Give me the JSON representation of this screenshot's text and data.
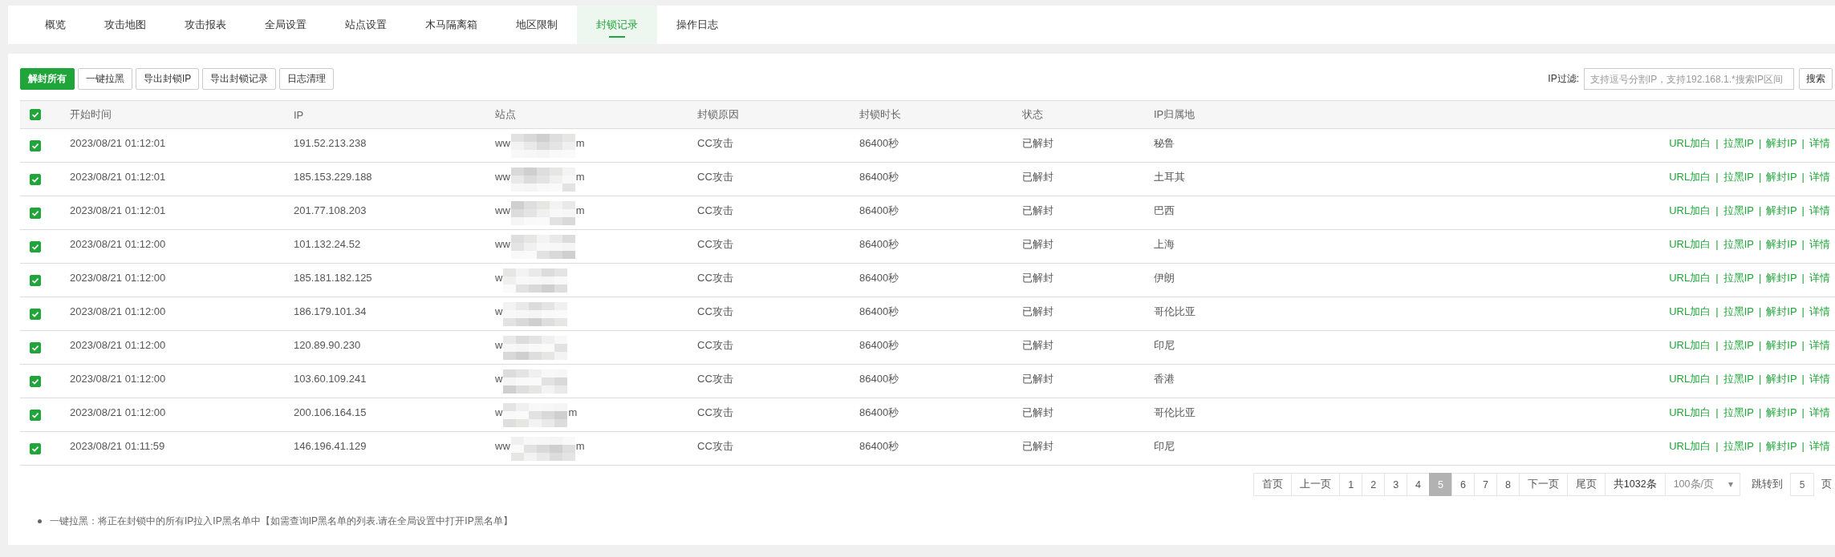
{
  "tabs": [
    {
      "label": "概览",
      "selected": false
    },
    {
      "label": "攻击地图",
      "selected": false
    },
    {
      "label": "攻击报表",
      "selected": false
    },
    {
      "label": "全局设置",
      "selected": false
    },
    {
      "label": "站点设置",
      "selected": false
    },
    {
      "label": "木马隔离箱",
      "selected": false
    },
    {
      "label": "地区限制",
      "selected": false
    },
    {
      "label": "封锁记录",
      "selected": true
    },
    {
      "label": "操作日志",
      "selected": false
    }
  ],
  "toolbar": {
    "buttons": [
      {
        "label": "解封所有",
        "kind": "primary"
      },
      {
        "label": "一键拉黑",
        "kind": "default"
      },
      {
        "label": "导出封锁IP",
        "kind": "default"
      },
      {
        "label": "导出封锁记录",
        "kind": "default"
      },
      {
        "label": "日志清理",
        "kind": "default"
      }
    ],
    "filter_label": "IP过滤:",
    "filter": {
      "placeholder": "支持逗号分割IP，支持192.168.1.*搜索IP区间"
    },
    "search_button": "搜索"
  },
  "table": {
    "select_all_checked": true,
    "columns": [
      "开始时间",
      "IP",
      "站点",
      "封锁原因",
      "封锁时长",
      "状态",
      "IP归属地"
    ],
    "action_separator": "|",
    "rows": [
      {
        "checked": true,
        "time": "2023/08/21 01:12:01",
        "ip": "191.52.213.238",
        "site": {
          "prefix": "ww",
          "suffix": "m",
          "redacted": true
        },
        "reason": "CC攻击",
        "duration": "86400秒",
        "status": "已解封",
        "location": "秘鲁",
        "actions": [
          "URL加白",
          "拉黑IP",
          "解封IP",
          "详情"
        ]
      },
      {
        "checked": true,
        "time": "2023/08/21 01:12:01",
        "ip": "185.153.229.188",
        "site": {
          "prefix": "ww",
          "suffix": "m",
          "redacted": true
        },
        "reason": "CC攻击",
        "duration": "86400秒",
        "status": "已解封",
        "location": "土耳其",
        "actions": [
          "URL加白",
          "拉黑IP",
          "解封IP",
          "详情"
        ]
      },
      {
        "checked": true,
        "time": "2023/08/21 01:12:01",
        "ip": "201.77.108.203",
        "site": {
          "prefix": "ww",
          "suffix": "m",
          "redacted": true
        },
        "reason": "CC攻击",
        "duration": "86400秒",
        "status": "已解封",
        "location": "巴西",
        "actions": [
          "URL加白",
          "拉黑IP",
          "解封IP",
          "详情"
        ]
      },
      {
        "checked": true,
        "time": "2023/08/21 01:12:00",
        "ip": "101.132.24.52",
        "site": {
          "prefix": "ww",
          "redacted": true
        },
        "reason": "CC攻击",
        "duration": "86400秒",
        "status": "已解封",
        "location": "上海",
        "actions": [
          "URL加白",
          "拉黑IP",
          "解封IP",
          "详情"
        ]
      },
      {
        "checked": true,
        "time": "2023/08/21 01:12:00",
        "ip": "185.181.182.125",
        "site": {
          "prefix": "w",
          "redacted": true
        },
        "reason": "CC攻击",
        "duration": "86400秒",
        "status": "已解封",
        "location": "伊朗",
        "actions": [
          "URL加白",
          "拉黑IP",
          "解封IP",
          "详情"
        ]
      },
      {
        "checked": true,
        "time": "2023/08/21 01:12:00",
        "ip": "186.179.101.34",
        "site": {
          "prefix": "w",
          "redacted": true
        },
        "reason": "CC攻击",
        "duration": "86400秒",
        "status": "已解封",
        "location": "哥伦比亚",
        "actions": [
          "URL加白",
          "拉黑IP",
          "解封IP",
          "详情"
        ]
      },
      {
        "checked": true,
        "time": "2023/08/21 01:12:00",
        "ip": "120.89.90.230",
        "site": {
          "prefix": "w",
          "redacted": true
        },
        "reason": "CC攻击",
        "duration": "86400秒",
        "status": "已解封",
        "location": "印尼",
        "actions": [
          "URL加白",
          "拉黑IP",
          "解封IP",
          "详情"
        ]
      },
      {
        "checked": true,
        "time": "2023/08/21 01:12:00",
        "ip": "103.60.109.241",
        "site": {
          "prefix": "w",
          "redacted": true
        },
        "reason": "CC攻击",
        "duration": "86400秒",
        "status": "已解封",
        "location": "香港",
        "actions": [
          "URL加白",
          "拉黑IP",
          "解封IP",
          "详情"
        ]
      },
      {
        "checked": true,
        "time": "2023/08/21 01:12:00",
        "ip": "200.106.164.15",
        "site": {
          "prefix": "w",
          "suffix": "m",
          "redacted": true
        },
        "reason": "CC攻击",
        "duration": "86400秒",
        "status": "已解封",
        "location": "哥伦比亚",
        "actions": [
          "URL加白",
          "拉黑IP",
          "解封IP",
          "详情"
        ]
      },
      {
        "checked": true,
        "time": "2023/08/21 01:11:59",
        "ip": "146.196.41.129",
        "site": {
          "prefix": "ww",
          "suffix": "m",
          "redacted": true
        },
        "reason": "CC攻击",
        "duration": "86400秒",
        "status": "已解封",
        "location": "印尼",
        "actions": [
          "URL加白",
          "拉黑IP",
          "解封IP",
          "详情"
        ]
      }
    ]
  },
  "pagination": {
    "items": [
      {
        "label": "首页",
        "selected": false
      },
      {
        "label": "上一页",
        "selected": false
      },
      {
        "label": "1",
        "selected": false
      },
      {
        "label": "2",
        "selected": false
      },
      {
        "label": "3",
        "selected": false
      },
      {
        "label": "4",
        "selected": false
      },
      {
        "label": "5",
        "selected": true
      },
      {
        "label": "6",
        "selected": false
      },
      {
        "label": "7",
        "selected": false
      },
      {
        "label": "8",
        "selected": false
      },
      {
        "label": "下一页",
        "selected": false
      },
      {
        "label": "尾页",
        "selected": false
      }
    ],
    "total": "共1032条",
    "page_size": "100条/页",
    "jump_label": "跳转到",
    "jump_value": "5",
    "page_unit": "页"
  },
  "notes": [
    "一键拉黑：将正在封锁中的所有IP拉入IP黑名单中【如需查询IP黑名单的列表.请在全局设置中打开IP黑名单】"
  ]
}
